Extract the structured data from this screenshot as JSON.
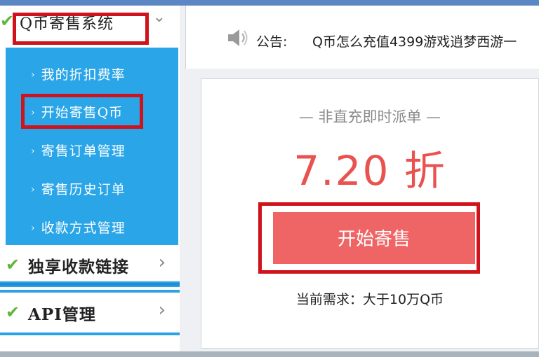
{
  "sidebar": {
    "system_menu": {
      "title": "Q币寄售系统",
      "chevron_icon": "chevron-down-icon",
      "check_icon": "check-icon"
    },
    "sub_items": [
      {
        "label": "我的折扣费率"
      },
      {
        "label": "开始寄售Q币"
      },
      {
        "label": "寄售订单管理"
      },
      {
        "label": "寄售历史订单"
      },
      {
        "label": "收款方式管理"
      }
    ],
    "exclusive_link": {
      "title": "独享收款链接",
      "chevron_icon": "chevron-right-icon"
    },
    "api_menu": {
      "title": "API管理",
      "chevron_icon": "chevron-right-icon"
    },
    "sub_arrow": "›",
    "chevron_down": "⌄",
    "chevron_right": "›",
    "check": "✔"
  },
  "notice": {
    "icon": "speaker-icon",
    "label": "公告:",
    "text": "Q币怎么充值4399游戏逍梦西游一"
  },
  "card": {
    "subtitle": "— 非直充即时派单 —",
    "discount": "7.20 折",
    "button_label": "开始寄售",
    "demand": "当前需求：大于10万Q币"
  },
  "colors": {
    "sidebar_blue": "#29a5e8",
    "highlight_red": "#d0121b",
    "discount_red": "#e8534f",
    "button_red": "#ef6464",
    "check_green": "#61b53a"
  }
}
